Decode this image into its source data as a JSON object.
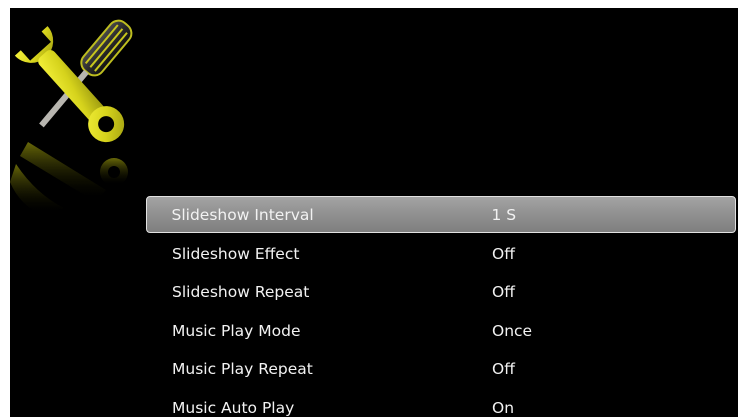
{
  "icon": "wrench-screwdriver-settings-icon",
  "colors": {
    "background": "#000000",
    "icon_accent": "#d4d21c",
    "selection_fill": "#8e8e8e",
    "text": "#f2f2f2"
  },
  "settings": {
    "selected_index": 0,
    "items": [
      {
        "label": "Slideshow Interval",
        "value": "1 S"
      },
      {
        "label": "Slideshow Effect",
        "value": "Off"
      },
      {
        "label": "Slideshow Repeat",
        "value": "Off"
      },
      {
        "label": "Music Play Mode",
        "value": "Once"
      },
      {
        "label": "Music Play Repeat",
        "value": "Off"
      },
      {
        "label": "Music Auto Play",
        "value": "On"
      }
    ]
  }
}
